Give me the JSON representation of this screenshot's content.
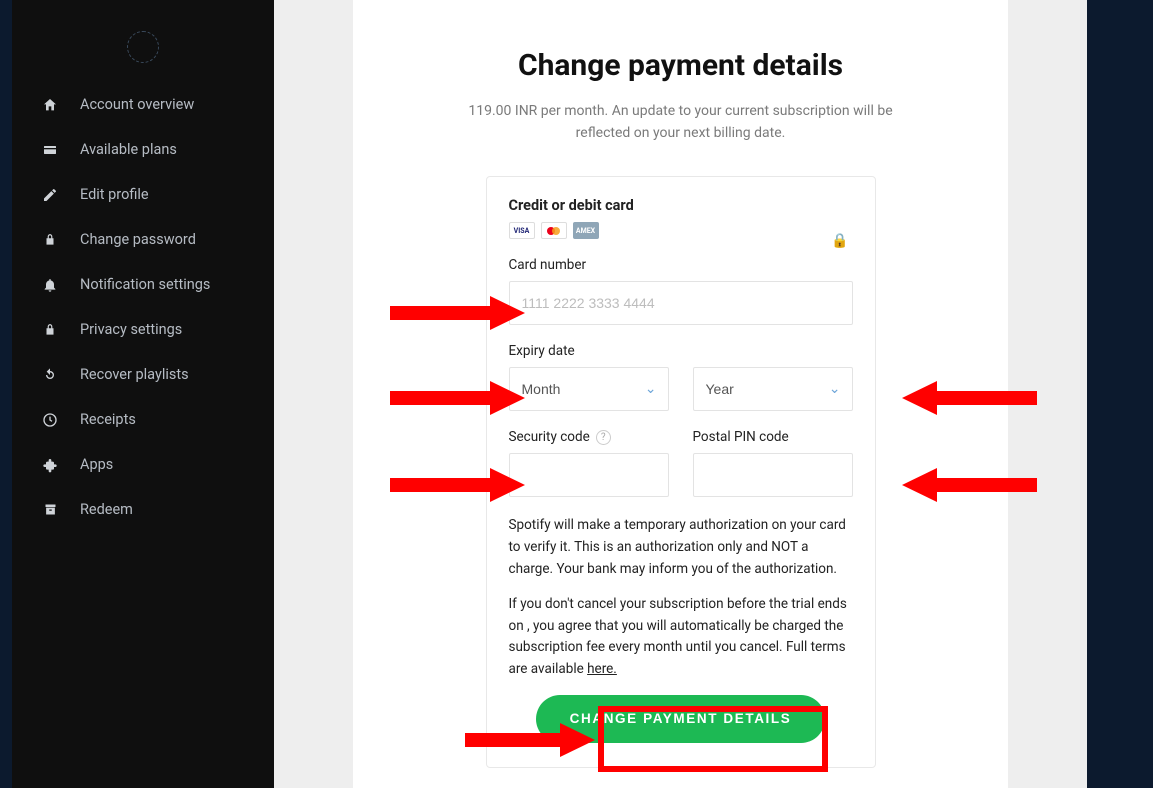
{
  "sidebar": {
    "items": [
      {
        "label": "Account overview"
      },
      {
        "label": "Available plans"
      },
      {
        "label": "Edit profile"
      },
      {
        "label": "Change password"
      },
      {
        "label": "Notification settings"
      },
      {
        "label": "Privacy settings"
      },
      {
        "label": "Recover playlists"
      },
      {
        "label": "Receipts"
      },
      {
        "label": "Apps"
      },
      {
        "label": "Redeem"
      }
    ]
  },
  "page": {
    "title": "Change payment details",
    "subtitle": "119.00 INR per month. An update to your current subscription will be reflected on your next billing date."
  },
  "form": {
    "cc_section_label": "Credit or debit card",
    "visa_text": "VISA",
    "amex_text": "AMEX",
    "card_number_label": "Card number",
    "card_number_placeholder": "1111 2222 3333 4444",
    "expiry_label": "Expiry date",
    "month_placeholder": "Month",
    "year_placeholder": "Year",
    "security_label": "Security code",
    "pin_label": "Postal PIN code",
    "auth_text": "Spotify will make a temporary authorization on your card to verify it. This is an authorization only and NOT a charge. Your bank may inform you of the authorization.",
    "cancel_text_1": "If you don't cancel your subscription before the trial ends on , you agree that you will automatically be charged the subscription fee every month until you cancel. Full terms are available ",
    "here_text": "here.",
    "submit_label": "CHANGE PAYMENT DETAILS"
  }
}
